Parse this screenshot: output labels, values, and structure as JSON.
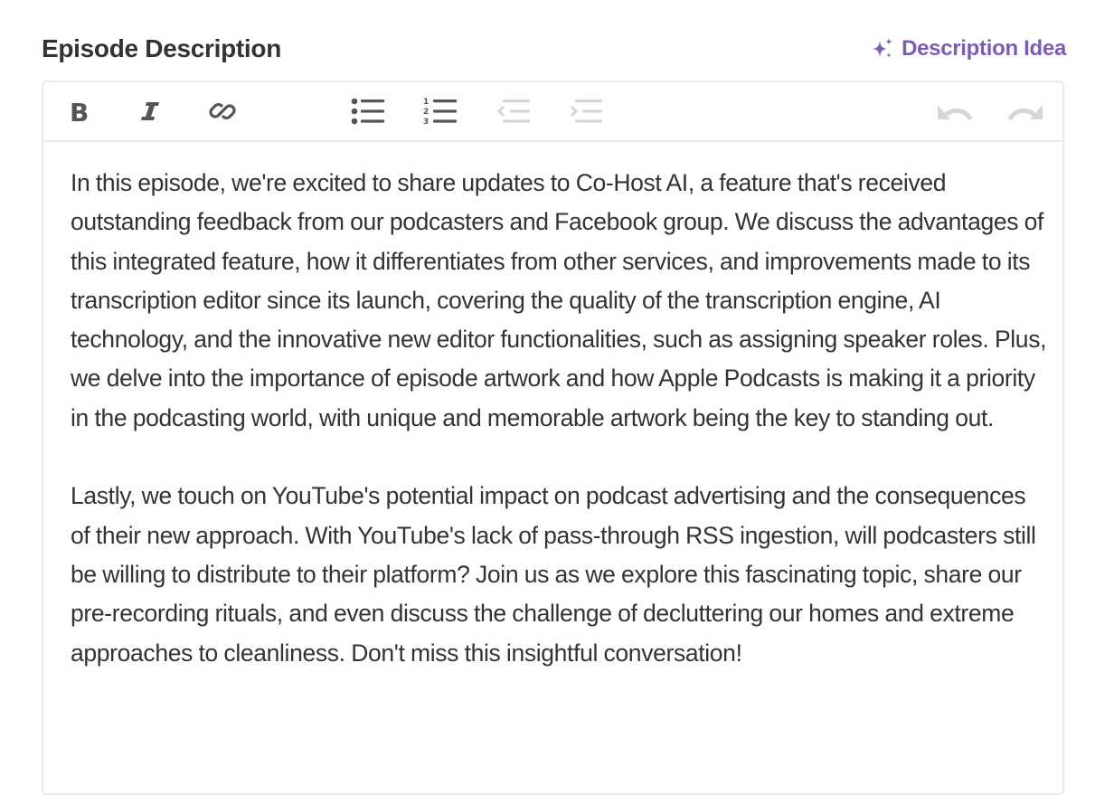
{
  "header": {
    "title": "Episode Description",
    "idea_button": {
      "label": "Description Idea",
      "icon": "sparkles-icon",
      "color": "#7c5cb5"
    }
  },
  "toolbar": {
    "buttons": [
      {
        "name": "bold",
        "icon": "bold-icon",
        "enabled": true
      },
      {
        "name": "italic",
        "icon": "italic-icon",
        "enabled": true
      },
      {
        "name": "link",
        "icon": "link-icon",
        "enabled": true
      },
      {
        "name": "bulleted-list",
        "icon": "bulleted-list-icon",
        "enabled": true
      },
      {
        "name": "numbered-list",
        "icon": "numbered-list-icon",
        "enabled": true
      },
      {
        "name": "outdent",
        "icon": "outdent-icon",
        "enabled": false
      },
      {
        "name": "indent",
        "icon": "indent-icon",
        "enabled": false
      },
      {
        "name": "undo",
        "icon": "undo-icon",
        "enabled": false
      },
      {
        "name": "redo",
        "icon": "redo-icon",
        "enabled": false
      }
    ],
    "colors": {
      "enabled": "#555555",
      "disabled": "#d6d6d6"
    }
  },
  "editor": {
    "paragraphs": [
      "In this episode, we're excited to share updates to Co-Host AI, a feature that's received outstanding feedback from our podcasters and Facebook group. We discuss the advantages of this integrated feature, how it differentiates from other services, and improvements made to its transcription editor since its launch, covering the quality of the transcription engine, AI technology, and the innovative new editor functionalities, such as assigning speaker roles. Plus, we delve into the importance of episode artwork and how Apple Podcasts is making it a priority in the podcasting world, with unique and memorable artwork being the key to standing out.",
      "Lastly, we touch on YouTube's potential impact on podcast advertising and the consequences of their new approach. With YouTube's lack of pass-through RSS ingestion, will podcasters still be willing to distribute to their platform? Join us as we explore this fascinating topic, share our pre-recording rituals, and even discuss the challenge of decluttering our homes and extreme approaches to cleanliness. Don't miss this insightful conversation!"
    ]
  }
}
